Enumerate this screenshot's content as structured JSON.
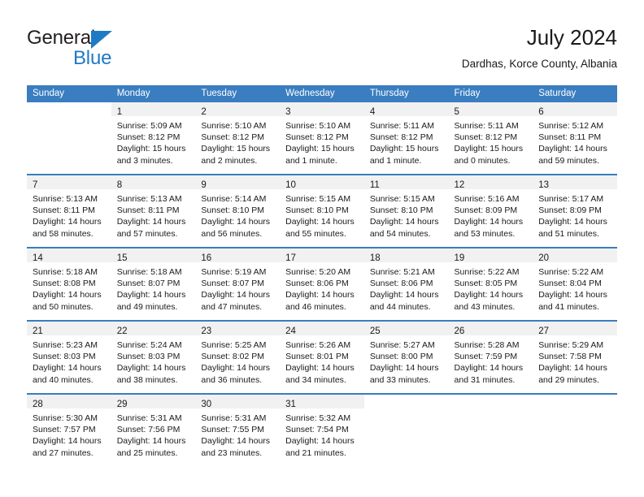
{
  "brand": {
    "name_part1": "General",
    "name_part2": "Blue",
    "triangle_icon": "blue-triangle-logo-mark",
    "color_dark": "#231f20",
    "color_blue": "#1f7ac4"
  },
  "header": {
    "title": "July 2024",
    "subtitle": "Dardhas, Korce County, Albania"
  },
  "calendar": {
    "accent_color": "#3a7dc0",
    "daynum_band_color": "#f1f1f1",
    "weekday_headers": [
      "Sunday",
      "Monday",
      "Tuesday",
      "Wednesday",
      "Thursday",
      "Friday",
      "Saturday"
    ],
    "weeks": [
      [
        {
          "day": "",
          "lines": []
        },
        {
          "day": "1",
          "lines": [
            "Sunrise: 5:09 AM",
            "Sunset: 8:12 PM",
            "Daylight: 15 hours",
            "and 3 minutes."
          ]
        },
        {
          "day": "2",
          "lines": [
            "Sunrise: 5:10 AM",
            "Sunset: 8:12 PM",
            "Daylight: 15 hours",
            "and 2 minutes."
          ]
        },
        {
          "day": "3",
          "lines": [
            "Sunrise: 5:10 AM",
            "Sunset: 8:12 PM",
            "Daylight: 15 hours",
            "and 1 minute."
          ]
        },
        {
          "day": "4",
          "lines": [
            "Sunrise: 5:11 AM",
            "Sunset: 8:12 PM",
            "Daylight: 15 hours",
            "and 1 minute."
          ]
        },
        {
          "day": "5",
          "lines": [
            "Sunrise: 5:11 AM",
            "Sunset: 8:12 PM",
            "Daylight: 15 hours",
            "and 0 minutes."
          ]
        },
        {
          "day": "6",
          "lines": [
            "Sunrise: 5:12 AM",
            "Sunset: 8:11 PM",
            "Daylight: 14 hours",
            "and 59 minutes."
          ]
        }
      ],
      [
        {
          "day": "7",
          "lines": [
            "Sunrise: 5:13 AM",
            "Sunset: 8:11 PM",
            "Daylight: 14 hours",
            "and 58 minutes."
          ]
        },
        {
          "day": "8",
          "lines": [
            "Sunrise: 5:13 AM",
            "Sunset: 8:11 PM",
            "Daylight: 14 hours",
            "and 57 minutes."
          ]
        },
        {
          "day": "9",
          "lines": [
            "Sunrise: 5:14 AM",
            "Sunset: 8:10 PM",
            "Daylight: 14 hours",
            "and 56 minutes."
          ]
        },
        {
          "day": "10",
          "lines": [
            "Sunrise: 5:15 AM",
            "Sunset: 8:10 PM",
            "Daylight: 14 hours",
            "and 55 minutes."
          ]
        },
        {
          "day": "11",
          "lines": [
            "Sunrise: 5:15 AM",
            "Sunset: 8:10 PM",
            "Daylight: 14 hours",
            "and 54 minutes."
          ]
        },
        {
          "day": "12",
          "lines": [
            "Sunrise: 5:16 AM",
            "Sunset: 8:09 PM",
            "Daylight: 14 hours",
            "and 53 minutes."
          ]
        },
        {
          "day": "13",
          "lines": [
            "Sunrise: 5:17 AM",
            "Sunset: 8:09 PM",
            "Daylight: 14 hours",
            "and 51 minutes."
          ]
        }
      ],
      [
        {
          "day": "14",
          "lines": [
            "Sunrise: 5:18 AM",
            "Sunset: 8:08 PM",
            "Daylight: 14 hours",
            "and 50 minutes."
          ]
        },
        {
          "day": "15",
          "lines": [
            "Sunrise: 5:18 AM",
            "Sunset: 8:07 PM",
            "Daylight: 14 hours",
            "and 49 minutes."
          ]
        },
        {
          "day": "16",
          "lines": [
            "Sunrise: 5:19 AM",
            "Sunset: 8:07 PM",
            "Daylight: 14 hours",
            "and 47 minutes."
          ]
        },
        {
          "day": "17",
          "lines": [
            "Sunrise: 5:20 AM",
            "Sunset: 8:06 PM",
            "Daylight: 14 hours",
            "and 46 minutes."
          ]
        },
        {
          "day": "18",
          "lines": [
            "Sunrise: 5:21 AM",
            "Sunset: 8:06 PM",
            "Daylight: 14 hours",
            "and 44 minutes."
          ]
        },
        {
          "day": "19",
          "lines": [
            "Sunrise: 5:22 AM",
            "Sunset: 8:05 PM",
            "Daylight: 14 hours",
            "and 43 minutes."
          ]
        },
        {
          "day": "20",
          "lines": [
            "Sunrise: 5:22 AM",
            "Sunset: 8:04 PM",
            "Daylight: 14 hours",
            "and 41 minutes."
          ]
        }
      ],
      [
        {
          "day": "21",
          "lines": [
            "Sunrise: 5:23 AM",
            "Sunset: 8:03 PM",
            "Daylight: 14 hours",
            "and 40 minutes."
          ]
        },
        {
          "day": "22",
          "lines": [
            "Sunrise: 5:24 AM",
            "Sunset: 8:03 PM",
            "Daylight: 14 hours",
            "and 38 minutes."
          ]
        },
        {
          "day": "23",
          "lines": [
            "Sunrise: 5:25 AM",
            "Sunset: 8:02 PM",
            "Daylight: 14 hours",
            "and 36 minutes."
          ]
        },
        {
          "day": "24",
          "lines": [
            "Sunrise: 5:26 AM",
            "Sunset: 8:01 PM",
            "Daylight: 14 hours",
            "and 34 minutes."
          ]
        },
        {
          "day": "25",
          "lines": [
            "Sunrise: 5:27 AM",
            "Sunset: 8:00 PM",
            "Daylight: 14 hours",
            "and 33 minutes."
          ]
        },
        {
          "day": "26",
          "lines": [
            "Sunrise: 5:28 AM",
            "Sunset: 7:59 PM",
            "Daylight: 14 hours",
            "and 31 minutes."
          ]
        },
        {
          "day": "27",
          "lines": [
            "Sunrise: 5:29 AM",
            "Sunset: 7:58 PM",
            "Daylight: 14 hours",
            "and 29 minutes."
          ]
        }
      ],
      [
        {
          "day": "28",
          "lines": [
            "Sunrise: 5:30 AM",
            "Sunset: 7:57 PM",
            "Daylight: 14 hours",
            "and 27 minutes."
          ]
        },
        {
          "day": "29",
          "lines": [
            "Sunrise: 5:31 AM",
            "Sunset: 7:56 PM",
            "Daylight: 14 hours",
            "and 25 minutes."
          ]
        },
        {
          "day": "30",
          "lines": [
            "Sunrise: 5:31 AM",
            "Sunset: 7:55 PM",
            "Daylight: 14 hours",
            "and 23 minutes."
          ]
        },
        {
          "day": "31",
          "lines": [
            "Sunrise: 5:32 AM",
            "Sunset: 7:54 PM",
            "Daylight: 14 hours",
            "and 21 minutes."
          ]
        },
        {
          "day": "",
          "lines": []
        },
        {
          "day": "",
          "lines": []
        },
        {
          "day": "",
          "lines": []
        }
      ]
    ]
  }
}
